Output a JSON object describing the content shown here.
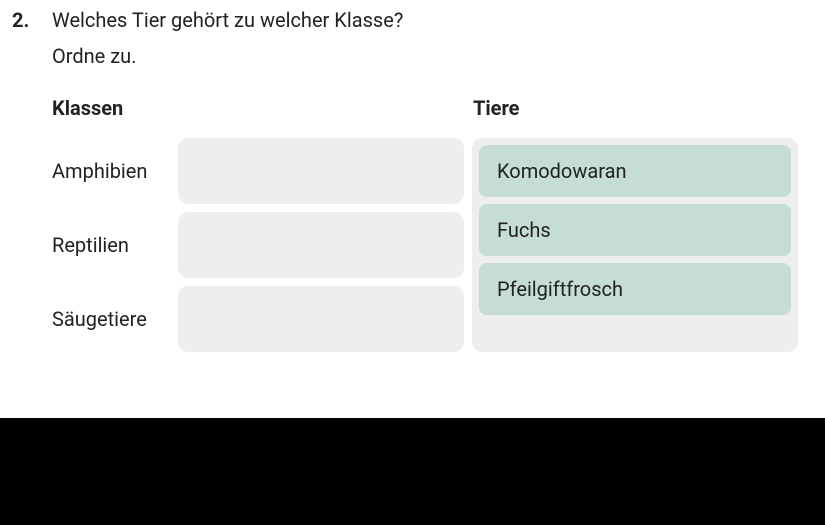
{
  "question": {
    "number": "2.",
    "title": "Welches Tier gehört zu welcher Klasse?",
    "instruction": "Ordne zu."
  },
  "headers": {
    "left": "Klassen",
    "right": "Tiere"
  },
  "classes": {
    "0": {
      "label": "Amphibien"
    },
    "1": {
      "label": "Reptilien"
    },
    "2": {
      "label": "Säugetiere"
    }
  },
  "animals": {
    "0": {
      "label": "Komodowaran"
    },
    "1": {
      "label": "Fuchs"
    },
    "2": {
      "label": "Pfeilgiftfrosch"
    }
  }
}
